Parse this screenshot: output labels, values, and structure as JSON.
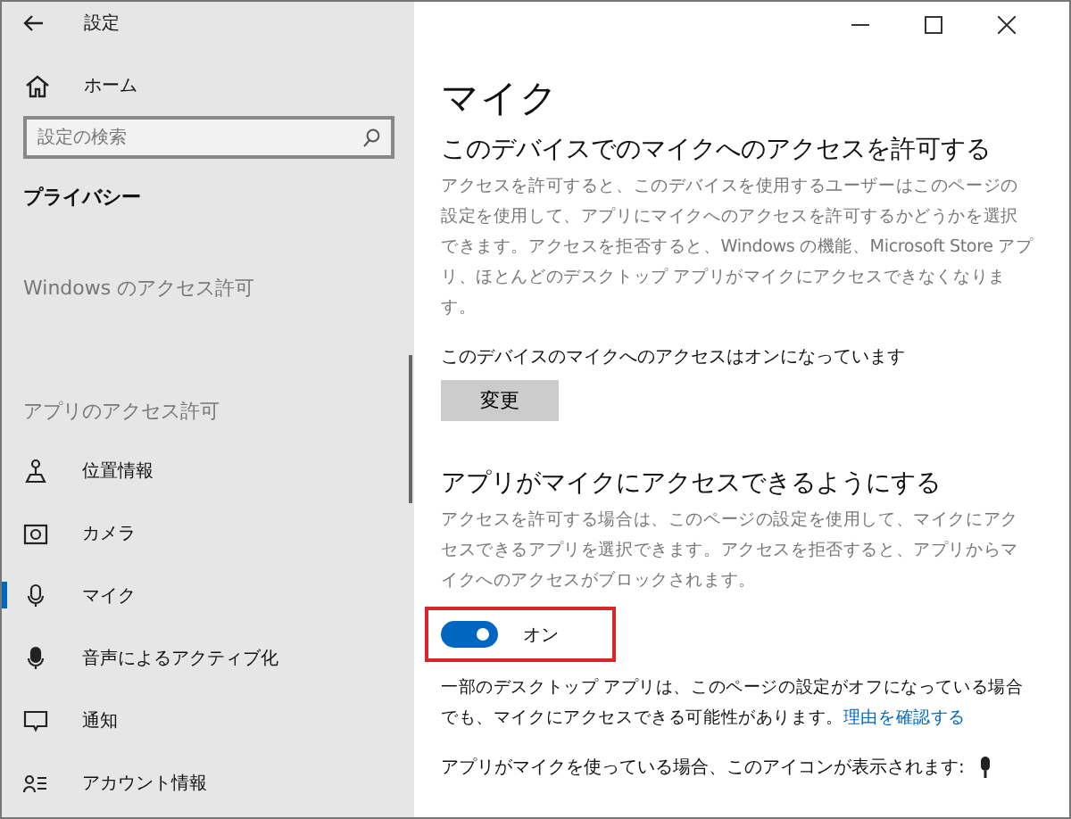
{
  "window": {
    "title": "設定"
  },
  "sidebar": {
    "home": "ホーム",
    "search": {
      "placeholder": "設定の検索"
    },
    "section": "プライバシー",
    "groups": [
      {
        "title": "Windows のアクセス許可"
      },
      {
        "title": "アプリのアクセス許可",
        "items": [
          {
            "label": "位置情報",
            "selected": false
          },
          {
            "label": "カメラ",
            "selected": false
          },
          {
            "label": "マイク",
            "selected": true
          },
          {
            "label": "音声によるアクティブ化",
            "selected": false
          },
          {
            "label": "通知",
            "selected": false
          },
          {
            "label": "アカウント情報",
            "selected": false
          }
        ]
      }
    ]
  },
  "page": {
    "title": "マイク",
    "device": {
      "heading": "このデバイスでのマイクへのアクセスを許可する",
      "description": "アクセスを許可すると、このデバイスを使用するユーザーはこのページの設定を使用して、アプリにマイクへのアクセスを許可するかどうかを選択できます。アクセスを拒否すると、Windows の機能、Microsoft Store アプリ、ほとんどのデスクトップ アプリがマイクにアクセスできなくなります。",
      "status": "このデバイスのマイクへのアクセスはオンになっています",
      "button": "変更"
    },
    "apps": {
      "heading": "アプリがマイクにアクセスできるようにする",
      "description": "アクセスを許可する場合は、このページの設定を使用して、マイクにアクセスできるアプリを選択できます。アクセスを拒否すると、アプリからマイクへのアクセスがブロックされます。",
      "toggle": {
        "on": true,
        "label": "オン",
        "highlighted": true
      },
      "note": "一部のデスクトップ アプリは、このページの設定がオフになっている場合でも、マイクにアクセスできる可能性があります。",
      "link": "理由を確認する",
      "icon_note": "アプリがマイクを使っている場合、このアイコンが表示されます:"
    }
  }
}
